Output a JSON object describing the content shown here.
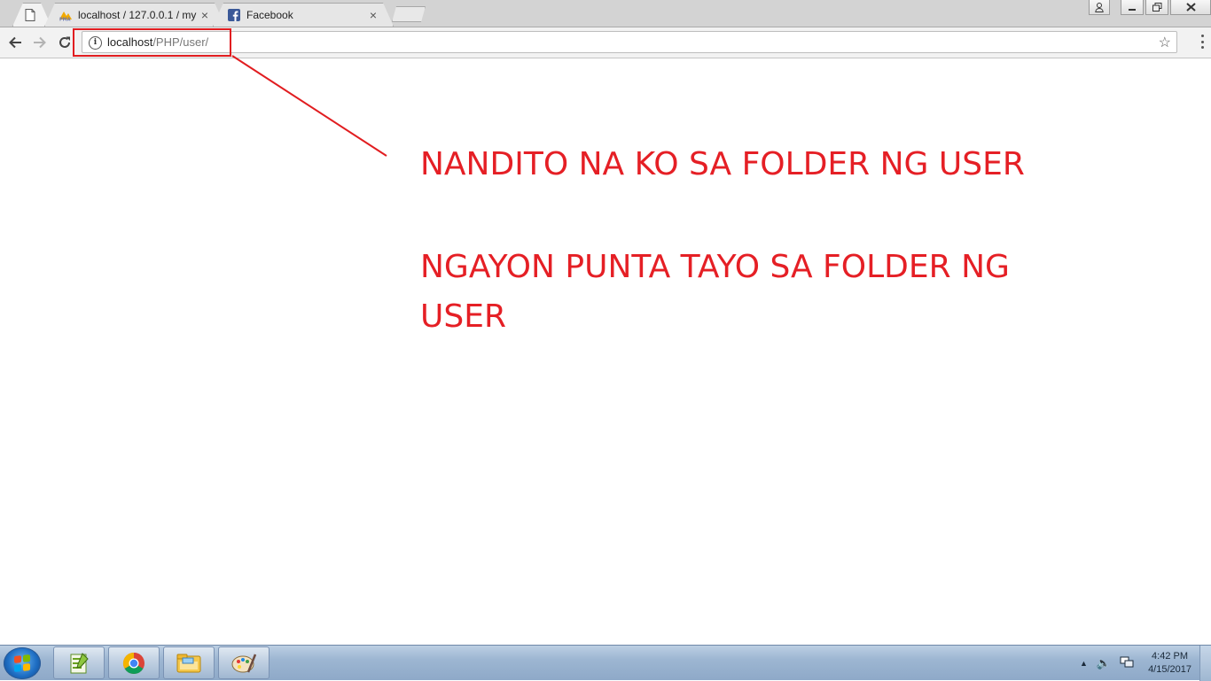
{
  "browser": {
    "tabs": [
      {
        "title": "",
        "favicon": "page-icon",
        "active": true
      },
      {
        "title": "localhost / 127.0.0.1 / my",
        "favicon": "phpmyadmin-icon",
        "active": false
      },
      {
        "title": "Facebook",
        "favicon": "facebook-icon",
        "active": false
      }
    ],
    "tab_close_glyph": "×",
    "window_controls": {
      "user": "user-icon",
      "minimize": "minimize-icon",
      "restore": "restore-icon",
      "close": "close-icon"
    }
  },
  "toolbar": {
    "back": "back-arrow-icon",
    "forward": "forward-arrow-icon",
    "reload": "reload-icon",
    "info_glyph": "i",
    "url_host": "localhost",
    "url_path": "/PHP/user/",
    "star_glyph": "☆"
  },
  "page": {
    "line1": "NANDITO NA KO SA FOLDER NG USER",
    "line2": "NGAYON PUNTA TAYO SA FOLDER NG USER",
    "annotation_color": "#e51f25"
  },
  "taskbar": {
    "apps": [
      "notepad-plus-icon",
      "chrome-icon",
      "file-explorer-icon",
      "paint-icon"
    ],
    "tray": {
      "arrow": "▲",
      "volume": "🔈",
      "network": "network-icon"
    },
    "time": "4:42 PM",
    "date": "4/15/2017"
  }
}
